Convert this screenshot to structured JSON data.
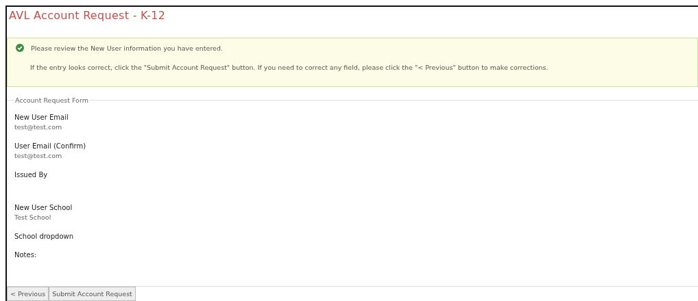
{
  "title": "AVL Account Request - K-12",
  "alert": {
    "message": "Please review the New User information you have entered.",
    "detail": "If the entry looks correct, click the \"Submit Account Request\" button.  If you need to correct any field, please click the \"< Previous\" button to make corrections."
  },
  "form": {
    "legend": "Account Request Form",
    "fields": [
      {
        "label": "New User Email",
        "value": "test@test.com"
      },
      {
        "label": "User Email (Confirm)",
        "value": "test@test.com"
      },
      {
        "label": "Issued By"
      },
      {
        "label": "New User School",
        "value": "Test School"
      },
      {
        "label": "School dropdown"
      },
      {
        "label": "Notes:"
      }
    ]
  },
  "buttons": [
    "< Previous",
    "Submit Account Request"
  ]
}
